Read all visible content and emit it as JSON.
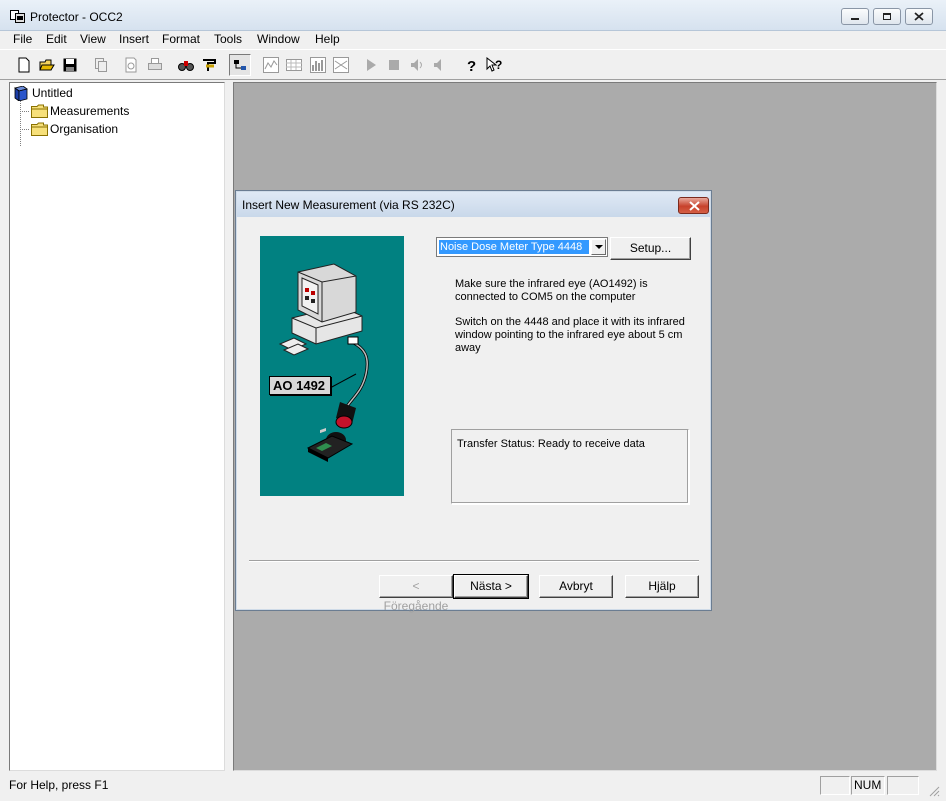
{
  "window": {
    "title": "Protector - OCC2"
  },
  "menu": [
    "File",
    "Edit",
    "View",
    "Insert",
    "Format",
    "Tools",
    "Window",
    "Help"
  ],
  "toolbar": {
    "buttons": [
      {
        "icon": "new-document-icon"
      },
      {
        "icon": "open-folder-icon"
      },
      {
        "icon": "save-icon"
      },
      {
        "icon": "copy-icon"
      },
      {
        "icon": "print-preview-icon"
      },
      {
        "icon": "print-icon"
      },
      {
        "icon": "binoculars-icon"
      },
      {
        "icon": "format-icon"
      },
      {
        "icon": "tree-view-icon"
      },
      {
        "icon": "spectrum-chart-icon"
      },
      {
        "icon": "table-icon"
      },
      {
        "icon": "bar-chart-icon"
      },
      {
        "icon": "scatter-chart-icon"
      },
      {
        "icon": "play-icon"
      },
      {
        "icon": "stop-icon"
      },
      {
        "icon": "speaker-icon"
      },
      {
        "icon": "speaker-mute-icon"
      },
      {
        "icon": "help-icon"
      },
      {
        "icon": "context-help-icon"
      }
    ]
  },
  "tree": {
    "root": "Untitled",
    "children": [
      "Measurements",
      "Organisation"
    ]
  },
  "dialog": {
    "title": "Insert New Measurement (via RS 232C)",
    "device_select": "Noise Dose Meter Type 4448",
    "setup_button": "Setup...",
    "illustration_label": "AO 1492",
    "instruction_1_line_1": "Make sure the infrared eye (AO1492) is",
    "instruction_1_line_2": "connected to COM5 on the computer",
    "instruction_2_line_1": "Switch on the 4448 and place it with its infrared",
    "instruction_2_line_2": "window pointing to the infrared eye about 5 cm",
    "instruction_2_line_3": "away",
    "transfer_status": "Transfer Status: Ready to receive data",
    "buttons": {
      "back": "< Föregående",
      "next": "Nästa >",
      "cancel": "Avbryt",
      "help": "Hjälp"
    }
  },
  "statusbar": {
    "help_text": "For Help, press F1",
    "num_indicator": "NUM"
  }
}
